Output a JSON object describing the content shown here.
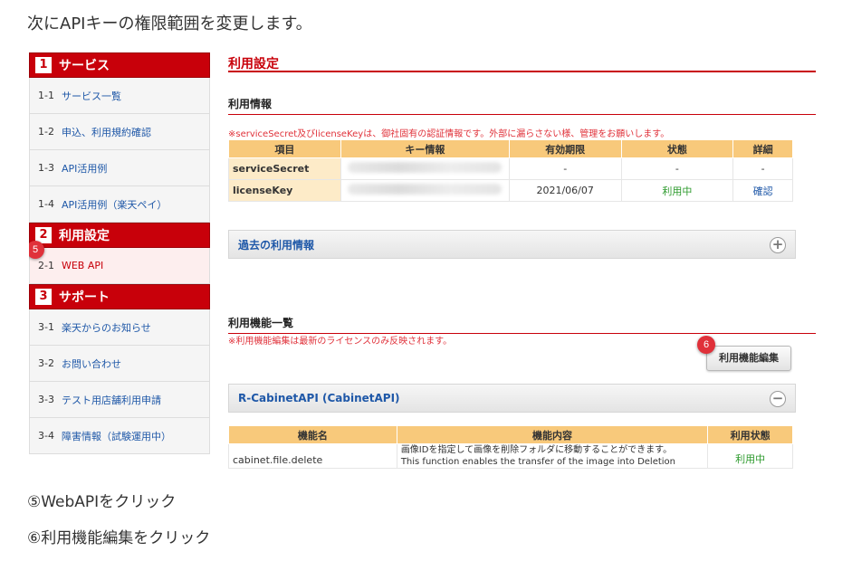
{
  "intro_text": "次にAPIキーの権限範囲を変更します。",
  "sidebar": {
    "sections": [
      {
        "num": "1",
        "title": "サービス"
      },
      {
        "num": "2",
        "title": "利用設定"
      },
      {
        "num": "3",
        "title": "サポート"
      }
    ],
    "items": [
      {
        "num": "1-1",
        "label": "サービス一覧"
      },
      {
        "num": "1-2",
        "label": "申込、利用規約確認"
      },
      {
        "num": "1-3",
        "label": "API活用例"
      },
      {
        "num": "1-4",
        "label": "API活用例（楽天ペイ）"
      },
      {
        "num": "2-1",
        "label": "WEB API"
      },
      {
        "num": "3-1",
        "label": "楽天からのお知らせ"
      },
      {
        "num": "3-2",
        "label": "お問い合わせ"
      },
      {
        "num": "3-3",
        "label": "テスト用店舗利用申請"
      },
      {
        "num": "3-4",
        "label": "障害情報（試験運用中）"
      }
    ]
  },
  "main": {
    "title": "利用設定",
    "usage_info": {
      "heading": "利用情報",
      "notice": "※serviceSecret及びlicenseKeyは、御社固有の認証情報です。外部に漏らさない様、管理をお願いします。",
      "columns": [
        "項目",
        "キー情報",
        "有効期限",
        "状態",
        "詳細"
      ],
      "rows": [
        {
          "item": "serviceSecret",
          "expiry": "-",
          "status": "-",
          "detail": "-"
        },
        {
          "item": "licenseKey",
          "expiry": "2021/06/07",
          "status": "利用中",
          "detail": "確認"
        }
      ]
    },
    "past_usage": "過去の利用情報",
    "feature_list": {
      "heading": "利用機能一覧",
      "notice": "※利用機能編集は最新のライセンスのみ反映されます。",
      "edit_button": "利用機能編集",
      "api_group": "R-CabinetAPI (CabinetAPI)",
      "columns": [
        "機能名",
        "機能内容",
        "利用状態"
      ],
      "rows": [
        {
          "name": "cabinet.file.delete",
          "desc_ja": "画像IDを指定して画像を削除フォルダに移動することができます。",
          "desc_en": "This function enables the transfer of the image into Deletion",
          "status": "利用中"
        }
      ]
    }
  },
  "badges": {
    "step5": "5",
    "step6": "6"
  },
  "captions": [
    "⑤WebAPIをクリック",
    "⑥利用機能編集をクリック"
  ],
  "colors": {
    "accent": "#c8000a",
    "link": "#1f58a8",
    "table_header": "#f8c97b",
    "status_green": "#2c9a2c"
  }
}
